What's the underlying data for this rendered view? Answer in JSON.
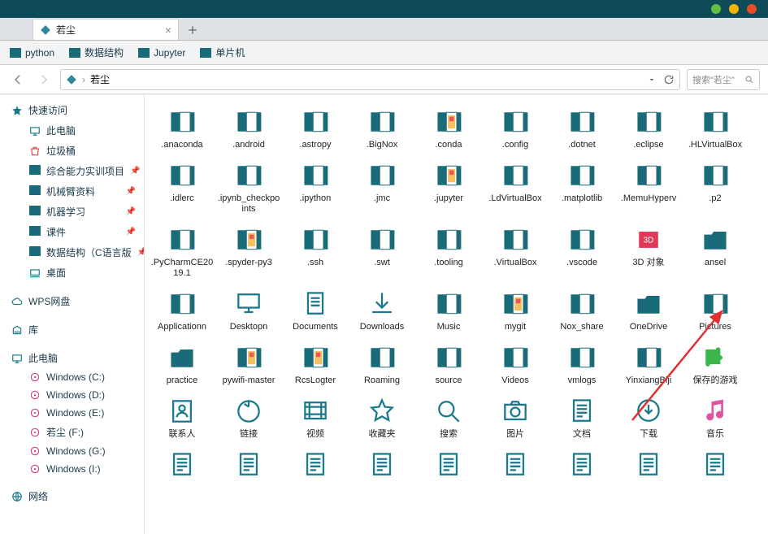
{
  "theme": {
    "accent": "#1a7a8c",
    "teal": "#0e4a58",
    "folder": "#1a6b7a"
  },
  "window_dots": [
    "#5dc13f",
    "#f5b400",
    "#e64d22"
  ],
  "tab": {
    "title": "若尘"
  },
  "bookmarks": [
    {
      "label": "python"
    },
    {
      "label": "数据结构"
    },
    {
      "label": "Jupyter"
    },
    {
      "label": "单片机"
    }
  ],
  "address": {
    "text": "若尘",
    "sep": "›"
  },
  "search": {
    "placeholder": "搜索\"若尘\""
  },
  "sidebar": {
    "section1": {
      "header": "快速访问",
      "items": [
        {
          "label": "此电脑",
          "ico": "pc"
        },
        {
          "label": "垃圾桶",
          "ico": "trash"
        },
        {
          "label": "综合能力实训项目",
          "ico": "folder",
          "pin": true
        },
        {
          "label": "机械臂资料",
          "ico": "folder",
          "pin": true
        },
        {
          "label": "机器学习",
          "ico": "folder",
          "pin": true
        },
        {
          "label": "课件",
          "ico": "folder",
          "pin": true
        },
        {
          "label": "数据结构（C语言版",
          "ico": "folder",
          "pin": true
        },
        {
          "label": "桌面",
          "ico": "desktop"
        }
      ]
    },
    "section2": {
      "header": "WPS网盘",
      "ico": "cloud"
    },
    "section3": {
      "header": "库",
      "ico": "lib"
    },
    "section4": {
      "header": "此电脑",
      "items": [
        {
          "label": "Windows (C:)",
          "ico": "disk"
        },
        {
          "label": "Windows (D:)",
          "ico": "disk"
        },
        {
          "label": "Windows (E:)",
          "ico": "disk"
        },
        {
          "label": "若尘 (F:)",
          "ico": "disk"
        },
        {
          "label": "Windows (G:)",
          "ico": "disk"
        },
        {
          "label": "Windows (I:)",
          "ico": "disk"
        }
      ]
    },
    "section5": {
      "header": "网络",
      "ico": "net"
    }
  },
  "items": [
    {
      "label": ".anaconda",
      "type": "folder"
    },
    {
      "label": ".android",
      "type": "folder"
    },
    {
      "label": ".astropy",
      "type": "folder"
    },
    {
      "label": ".BigNox",
      "type": "folder"
    },
    {
      "label": ".conda",
      "type": "folder-img"
    },
    {
      "label": ".config",
      "type": "folder"
    },
    {
      "label": ".dotnet",
      "type": "folder"
    },
    {
      "label": ".eclipse",
      "type": "folder"
    },
    {
      "label": ".HLVirtualBox",
      "type": "folder"
    },
    {
      "label": ".idlerc",
      "type": "folder"
    },
    {
      "label": ".ipynb_checkpoints",
      "type": "folder"
    },
    {
      "label": ".ipython",
      "type": "folder"
    },
    {
      "label": ".jmc",
      "type": "folder"
    },
    {
      "label": ".jupyter",
      "type": "folder-img"
    },
    {
      "label": ".LdVirtualBox",
      "type": "folder"
    },
    {
      "label": ".matplotlib",
      "type": "folder"
    },
    {
      "label": ".MemuHyperv",
      "type": "folder"
    },
    {
      "label": ".p2",
      "type": "folder"
    },
    {
      "label": ".PyCharmCE2019.1",
      "type": "folder"
    },
    {
      "label": ".spyder-py3",
      "type": "folder-img"
    },
    {
      "label": ".ssh",
      "type": "folder"
    },
    {
      "label": ".swt",
      "type": "folder"
    },
    {
      "label": ".tooling",
      "type": "folder"
    },
    {
      "label": ".VirtualBox",
      "type": "folder"
    },
    {
      "label": ".vscode",
      "type": "folder"
    },
    {
      "label": "3D 对象",
      "type": "3d"
    },
    {
      "label": "ansel",
      "type": "closed"
    },
    {
      "label": "Applicationn",
      "type": "folder"
    },
    {
      "label": "Desktopn",
      "type": "desktop"
    },
    {
      "label": "Documents",
      "type": "docs"
    },
    {
      "label": "Downloads",
      "type": "down"
    },
    {
      "label": "Music",
      "type": "folder"
    },
    {
      "label": "mygit",
      "type": "folder-img"
    },
    {
      "label": "Nox_share",
      "type": "folder"
    },
    {
      "label": "OneDrive",
      "type": "closed"
    },
    {
      "label": "Pictures",
      "type": "folder"
    },
    {
      "label": "practice",
      "type": "closed"
    },
    {
      "label": "pywifi-master",
      "type": "folder-img"
    },
    {
      "label": "RcsLogter",
      "type": "folder-img"
    },
    {
      "label": "Roaming",
      "type": "folder"
    },
    {
      "label": "source",
      "type": "folder"
    },
    {
      "label": "Videos",
      "type": "folder"
    },
    {
      "label": "vmlogs",
      "type": "folder"
    },
    {
      "label": "YinxiangBiji",
      "type": "folder"
    },
    {
      "label": "保存的游戏",
      "type": "puzzle"
    },
    {
      "label": "联系人",
      "type": "contacts"
    },
    {
      "label": "链接",
      "type": "links"
    },
    {
      "label": "视频",
      "type": "video"
    },
    {
      "label": "收藏夹",
      "type": "fav"
    },
    {
      "label": "搜索",
      "type": "search"
    },
    {
      "label": "图片",
      "type": "camera"
    },
    {
      "label": "文档",
      "type": "doclines"
    },
    {
      "label": "下载",
      "type": "download2"
    },
    {
      "label": "音乐",
      "type": "music"
    },
    {
      "label": "",
      "type": "doclines"
    },
    {
      "label": "",
      "type": "doclines"
    },
    {
      "label": "",
      "type": "doclines"
    },
    {
      "label": "",
      "type": "doclines"
    },
    {
      "label": "",
      "type": "doclines"
    },
    {
      "label": "",
      "type": "doclines"
    },
    {
      "label": "",
      "type": "doclines"
    },
    {
      "label": "",
      "type": "doclines"
    },
    {
      "label": "",
      "type": "doclines"
    }
  ]
}
